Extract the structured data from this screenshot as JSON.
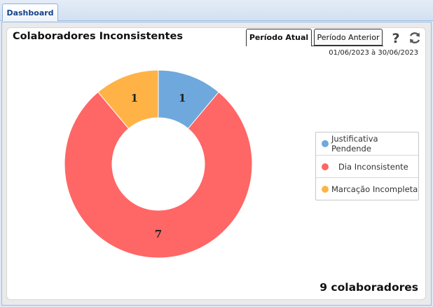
{
  "app": {
    "tab_label": "Dashboard"
  },
  "panel": {
    "title": "Colaboradores Inconsistentes",
    "tabs": [
      {
        "label": "Período Atual",
        "active": true
      },
      {
        "label": "Período Anterior",
        "active": false
      }
    ],
    "icons": [
      "help-icon",
      "refresh-icon"
    ],
    "date_range": "01/06/2023 à 30/06/2023",
    "total_label": "9 colaboradores"
  },
  "chart_data": {
    "type": "pie",
    "title": "",
    "legend_position": "right",
    "series": [
      {
        "name": "Justificativa Pendende",
        "value": 1,
        "color": "#6fa8dc"
      },
      {
        "name": "Dia Inconsistente",
        "value": 7,
        "color": "#ff6666"
      },
      {
        "name": "Marcação Incompleta",
        "value": 1,
        "color": "#ffb347"
      }
    ]
  }
}
